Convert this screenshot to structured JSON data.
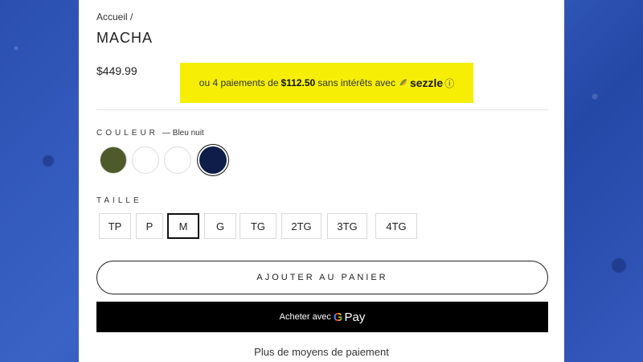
{
  "breadcrumb": "Accueil /",
  "product": {
    "title": "MACHA",
    "price": "$449.99"
  },
  "sezzle": {
    "prefix": "ou 4 paiements de",
    "amount": "$112.50",
    "suffix": "sans intérêts avec",
    "brand": "sezzle",
    "info_icon": "ⓘ",
    "bg_color": "#f6ef05"
  },
  "color": {
    "label": "COULEUR",
    "selected_value": "— Bleu nuit",
    "swatches": [
      {
        "name": "olive",
        "hex": "#4e5a2a"
      },
      {
        "name": "white-1",
        "hex": "#ffffff"
      },
      {
        "name": "white-2",
        "hex": "#ffffff"
      },
      {
        "name": "navy",
        "hex": "#0f1d4a"
      }
    ]
  },
  "size": {
    "label": "TAILLE",
    "options": [
      "TP",
      "P",
      "M",
      "G",
      "TG",
      "2TG",
      "3TG",
      "4TG"
    ],
    "selected": "M"
  },
  "actions": {
    "add_to_cart": "AJOUTER AU PANIER",
    "gpay_prefix": "Acheter avec",
    "gpay_g": "G",
    "gpay_pay": "Pay",
    "more_payment": "Plus de moyens de paiement"
  }
}
